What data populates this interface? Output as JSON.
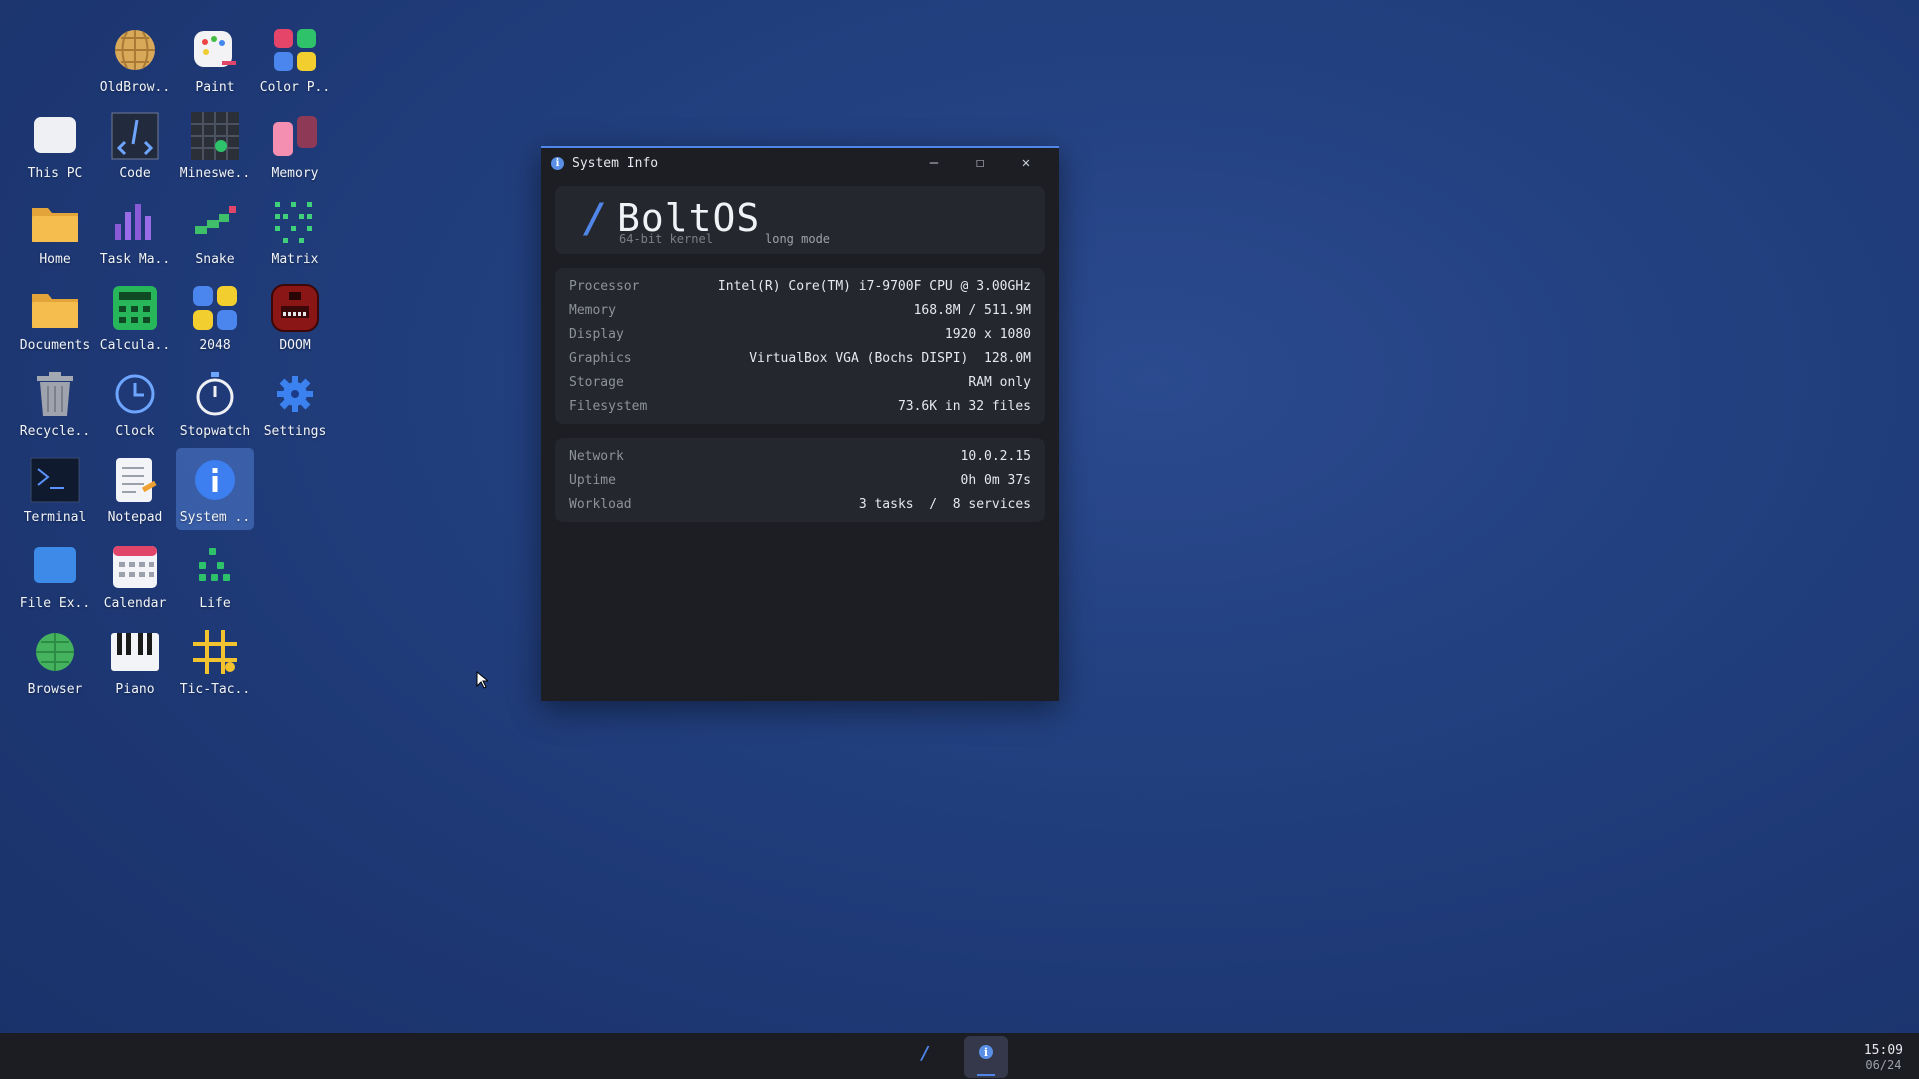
{
  "desktop": {
    "icons": [
      {
        "label": "OldBrow..",
        "icon": "globe-icon"
      },
      {
        "label": "Paint",
        "icon": "paint-icon"
      },
      {
        "label": "Color P..",
        "icon": "color-picker-icon"
      },
      {
        "label": "This PC",
        "icon": "computer-icon"
      },
      {
        "label": "Code",
        "icon": "code-icon"
      },
      {
        "label": "Mineswe..",
        "icon": "minesweeper-icon"
      },
      {
        "label": "Memory",
        "icon": "memory-game-icon"
      },
      {
        "label": "Home",
        "icon": "folder-icon"
      },
      {
        "label": "Task Ma..",
        "icon": "bar-chart-icon"
      },
      {
        "label": "Snake",
        "icon": "snake-icon"
      },
      {
        "label": "Matrix",
        "icon": "matrix-icon"
      },
      {
        "label": "Documents",
        "icon": "folder-icon"
      },
      {
        "label": "Calcula..",
        "icon": "calculator-icon"
      },
      {
        "label": "2048",
        "icon": "grid-2048-icon"
      },
      {
        "label": "DOOM",
        "icon": "doom-icon"
      },
      {
        "label": "Recycle..",
        "icon": "trash-icon"
      },
      {
        "label": "Clock",
        "icon": "clock-icon"
      },
      {
        "label": "Stopwatch",
        "icon": "stopwatch-icon"
      },
      {
        "label": "Settings",
        "icon": "gear-icon"
      },
      {
        "label": "Terminal",
        "icon": "terminal-icon"
      },
      {
        "label": "Notepad",
        "icon": "notepad-icon"
      },
      {
        "label": "System ..",
        "icon": "info-icon"
      },
      {
        "label": "File Ex..",
        "icon": "file-explorer-icon"
      },
      {
        "label": "Calendar",
        "icon": "calendar-icon"
      },
      {
        "label": "Life",
        "icon": "life-icon"
      },
      {
        "label": "Browser",
        "icon": "globe-icon"
      },
      {
        "label": "Piano",
        "icon": "piano-icon"
      },
      {
        "label": "Tic-Tac..",
        "icon": "tic-tac-toe-icon"
      }
    ]
  },
  "window": {
    "title": "System Info",
    "minimize": "–",
    "maximize": "☐",
    "close": "✕",
    "os_name": "BoltOS",
    "os_sub1": "64-bit kernel",
    "os_sub2": "long mode",
    "system_rows": [
      {
        "key": "Processor",
        "value": "Intel(R) Core(TM) i7-9700F CPU @ 3.00GHz"
      },
      {
        "key": "Memory",
        "value": "168.8M / 511.9M"
      },
      {
        "key": "Display",
        "value": "1920 x 1080"
      },
      {
        "key": "Graphics",
        "value": "VirtualBox VGA (Bochs DISPI)  128.0M"
      },
      {
        "key": "Storage",
        "value": "RAM only"
      },
      {
        "key": "Filesystem",
        "value": "73.6K in 32 files"
      }
    ],
    "network_rows": [
      {
        "key": "Network",
        "value": "10.0.2.15"
      },
      {
        "key": "Uptime",
        "value": "0h 0m 37s"
      },
      {
        "key": "Workload",
        "value": "3 tasks  /  8 services"
      }
    ]
  },
  "taskbar": {
    "bolt": "⚡",
    "clock_time": "15:09",
    "clock_date": "06/24"
  },
  "colors": {
    "accent": "#4f86e8",
    "window_bg": "#1c1e24",
    "card_bg": "#25272e"
  }
}
